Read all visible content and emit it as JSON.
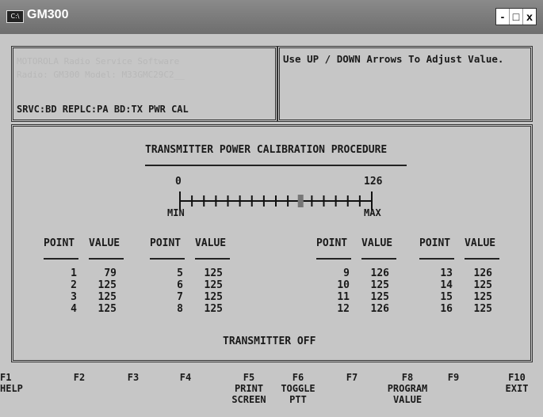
{
  "window": {
    "title": "GM300",
    "icon_label": "C:\\",
    "icon": "console-icon",
    "buttons": {
      "minimize": "-",
      "maximize": "□",
      "close": "x"
    }
  },
  "info_box": {
    "line1": "MOTOROLA Radio Service Software",
    "line2": "Radio: GM300   Model: M33GMC29C2__",
    "status": "SRVC:BD REPLC:PA BD:TX PWR CAL"
  },
  "hint_box": {
    "text": "Use UP / DOWN Arrows To Adjust Value."
  },
  "main": {
    "heading": "TRANSMITTER POWER CALIBRATION PROCEDURE",
    "scale": {
      "min_value": "0",
      "max_value": "126",
      "min_label": "MIN",
      "max_label": "MAX",
      "tick_count": 16,
      "current_value": 79,
      "range_max": 126
    },
    "columns": {
      "point": "POINT",
      "value": "VALUE"
    },
    "groups": [
      {
        "points": [
          {
            "p": "1",
            "v": "79"
          },
          {
            "p": "2",
            "v": "125"
          },
          {
            "p": "3",
            "v": "125"
          },
          {
            "p": "4",
            "v": "125"
          }
        ]
      },
      {
        "points": [
          {
            "p": "5",
            "v": "125"
          },
          {
            "p": "6",
            "v": "125"
          },
          {
            "p": "7",
            "v": "125"
          },
          {
            "p": "8",
            "v": "125"
          }
        ]
      },
      {
        "points": [
          {
            "p": "9",
            "v": "126"
          },
          {
            "p": "10",
            "v": "125"
          },
          {
            "p": "11",
            "v": "125"
          },
          {
            "p": "12",
            "v": "126"
          }
        ]
      },
      {
        "points": [
          {
            "p": "13",
            "v": "126"
          },
          {
            "p": "14",
            "v": "125"
          },
          {
            "p": "15",
            "v": "125"
          },
          {
            "p": "16",
            "v": "125"
          }
        ]
      }
    ],
    "status": "TRANSMITTER OFF"
  },
  "fkeys": [
    {
      "key": "F1",
      "label": "HELP"
    },
    {
      "key": "F2",
      "label": ""
    },
    {
      "key": "F3",
      "label": ""
    },
    {
      "key": "F4",
      "label": ""
    },
    {
      "key": "F5",
      "label": "PRINT\nSCREEN"
    },
    {
      "key": "F6",
      "label": "TOGGLE\nPTT"
    },
    {
      "key": "F7",
      "label": ""
    },
    {
      "key": "F8",
      "label": "PROGRAM\nVALUE"
    },
    {
      "key": "F9",
      "label": ""
    },
    {
      "key": "F10",
      "label": "EXIT"
    }
  ]
}
